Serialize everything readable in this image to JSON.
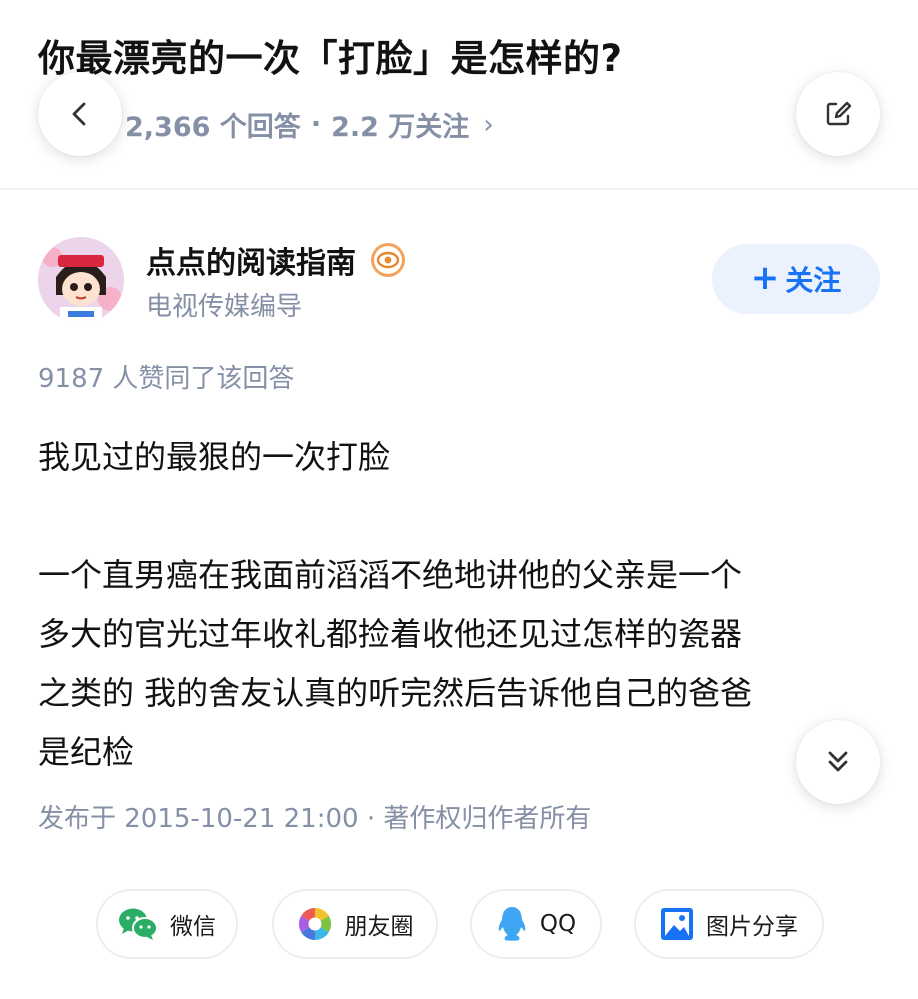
{
  "question": {
    "title": "你最漂亮的一次「打脸」是怎样的?",
    "answers": "2,366 个回答",
    "separator": "·",
    "followers": "2.2 万关注",
    "chevron": "›"
  },
  "nav": {
    "back_icon": "chevron-left-icon",
    "edit_icon": "edit-icon"
  },
  "author": {
    "name": "点点的阅读指南",
    "badge_icon": "eye-badge-icon",
    "description": "电视传媒编导",
    "follow_label": "关注",
    "follow_plus": "+"
  },
  "answer": {
    "votes": "9187 人赞同了该回答",
    "paragraph1": "我见过的最狠的一次打脸",
    "paragraph2_lines": [
      "一个直男癌在我面前滔滔不绝地讲他的父亲是一个",
      "多大的官光过年收礼都捡着收他还见过怎样的瓷器",
      "之类的 我的舍友认真的听完然后告诉他自己的爸爸",
      "是纪检"
    ],
    "published": "发布于 2015-10-21 21:00 · 著作权归作者所有"
  },
  "share": {
    "wechat": "微信",
    "moments": "朋友圈",
    "qq": "QQ",
    "image": "图片分享"
  },
  "colors": {
    "accent": "#1772f6",
    "follow_bg": "#ebf2fd",
    "meta_gray": "#8590a6",
    "wechat_green": "#2aae67",
    "qq_blue": "#3ea6f3"
  }
}
